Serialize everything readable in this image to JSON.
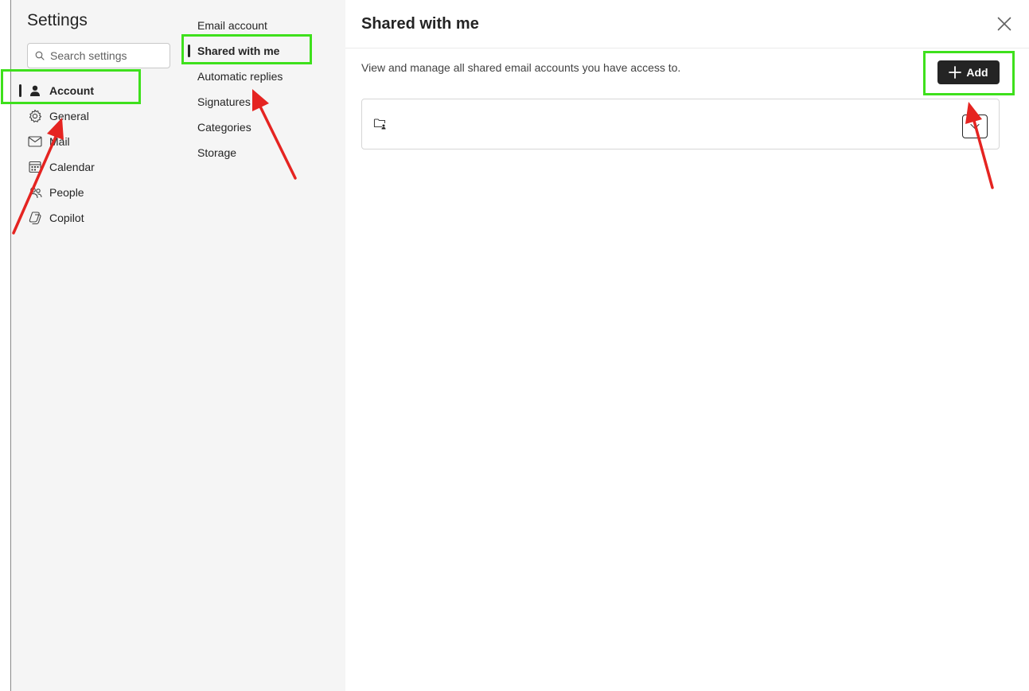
{
  "settings": {
    "title": "Settings",
    "search_placeholder": "Search settings"
  },
  "nav_primary": {
    "items": [
      {
        "label": "Account",
        "icon": "person-icon",
        "selected": true
      },
      {
        "label": "General",
        "icon": "gear-icon"
      },
      {
        "label": "Mail",
        "icon": "mail-icon"
      },
      {
        "label": "Calendar",
        "icon": "calendar-icon"
      },
      {
        "label": "People",
        "icon": "people-icon"
      },
      {
        "label": "Copilot",
        "icon": "copilot-icon"
      }
    ]
  },
  "nav_secondary": {
    "items": [
      {
        "label": "Email account"
      },
      {
        "label": "Shared with me",
        "selected": true
      },
      {
        "label": "Automatic replies"
      },
      {
        "label": "Signatures"
      },
      {
        "label": "Categories"
      },
      {
        "label": "Storage"
      }
    ]
  },
  "main": {
    "title": "Shared with me",
    "description": "View and manage all shared email accounts you have access to.",
    "add_label": "Add",
    "account_name": ""
  },
  "annotations": {
    "highlight_color": "#3ee01c",
    "arrow_color": "#e52421"
  }
}
